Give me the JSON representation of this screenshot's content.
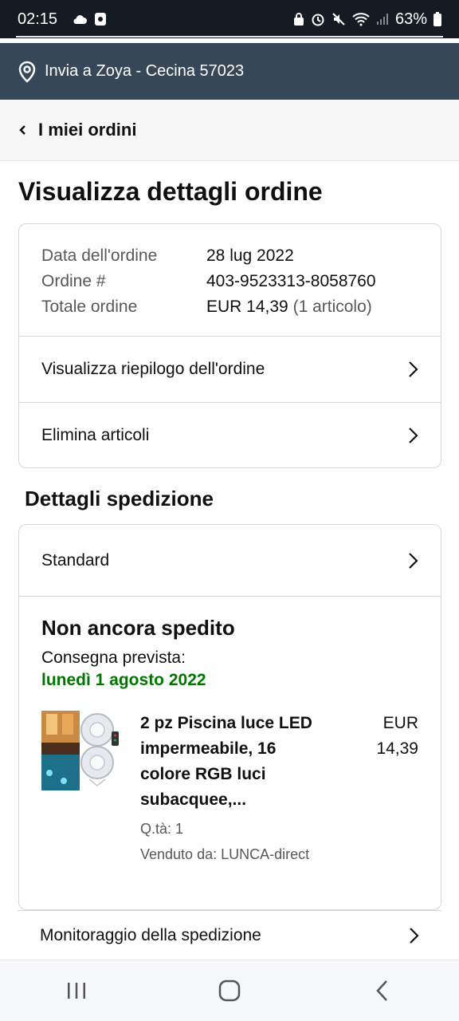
{
  "status_bar": {
    "time": "02:15",
    "battery": "63%"
  },
  "deliver_to": "Invia a Zoya - Cecina 57023",
  "back_link": "I miei ordini",
  "page_title": "Visualizza dettagli ordine",
  "order": {
    "date_label": "Data dell'ordine",
    "date_value": "28 lug 2022",
    "number_label": "Ordine #",
    "number_value": "403-9523313-8058760",
    "total_label": "Totale ordine",
    "total_value": "EUR 14,39",
    "total_items": "(1 articolo)",
    "summary_link": "Visualizza riepilogo dell'ordine",
    "delete_link": "Elimina articoli"
  },
  "shipping": {
    "section_title": "Dettagli spedizione",
    "method": "Standard",
    "status": "Non ancora spedito",
    "delivery_label": "Consegna prevista:",
    "delivery_date": "lunedì 1 agosto 2022",
    "item": {
      "title": "2 pz Piscina luce LED impermeabile, 16 colore RGB luci subacquee,...",
      "quantity": "Q.tà: 1",
      "seller": "Venduto da: LUNCA-direct",
      "price_currency": "EUR",
      "price_value": "14,39"
    },
    "tracking_link": "Monitoraggio della spedizione"
  },
  "colors": {
    "header": "#37475a",
    "status_bar": "#141b22",
    "delivery_green": "#007600"
  }
}
